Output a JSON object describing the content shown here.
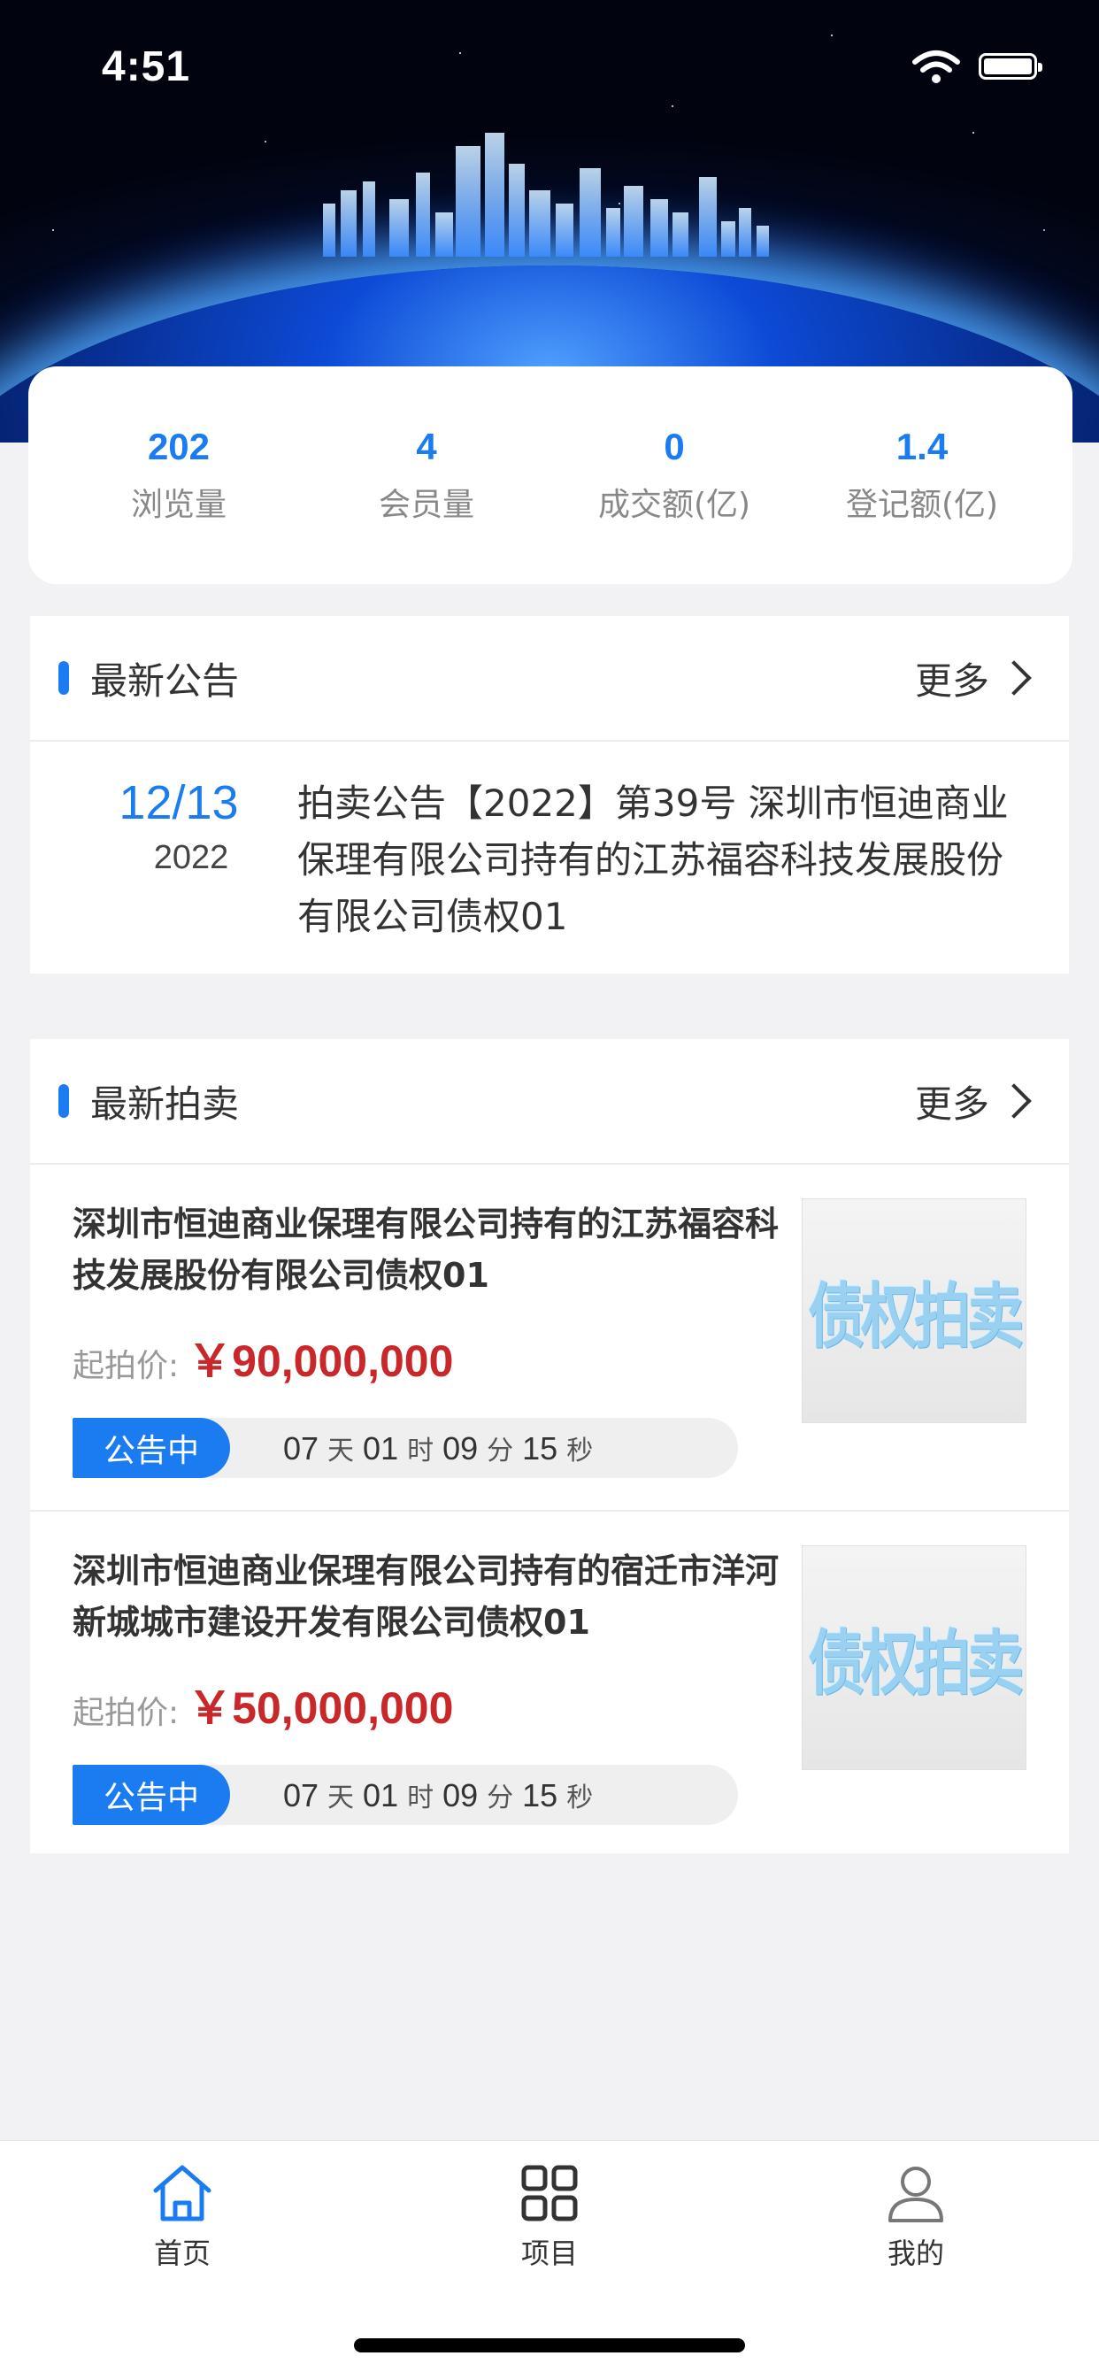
{
  "status_bar": {
    "time": "4:51"
  },
  "stats": [
    {
      "value": "202",
      "label": "浏览量"
    },
    {
      "value": "4",
      "label": "会员量"
    },
    {
      "value": "0",
      "label": "成交额(亿)"
    },
    {
      "value": "1.4",
      "label": "登记额(亿)"
    }
  ],
  "notices": {
    "title": "最新公告",
    "more": "更多",
    "items": [
      {
        "day": "12/13",
        "year": "2022",
        "text": "拍卖公告【2022】第39号 深圳市恒迪商业保理有限公司持有的江苏福容科技发展股份有限公司债权01"
      }
    ]
  },
  "auctions": {
    "title": "最新拍卖",
    "more": "更多",
    "items": [
      {
        "title": "深圳市恒迪商业保理有限公司持有的江苏福容科技发展股份有限公司债权01",
        "price_label": "起拍价:",
        "price": "￥90,000,000",
        "status": "公告中",
        "days": "07",
        "day_unit": "天",
        "hours": "01",
        "hour_unit": "时",
        "minutes": "09",
        "minute_unit": "分",
        "seconds": "15",
        "second_unit": "秒",
        "thumb_text": "债权拍卖"
      },
      {
        "title": "深圳市恒迪商业保理有限公司持有的宿迁市洋河新城城市建设开发有限公司债权01",
        "price_label": "起拍价:",
        "price": "￥50,000,000",
        "status": "公告中",
        "days": "07",
        "day_unit": "天",
        "hours": "01",
        "hour_unit": "时",
        "minutes": "09",
        "minute_unit": "分",
        "seconds": "15",
        "second_unit": "秒",
        "thumb_text": "债权拍卖"
      }
    ]
  },
  "tab_bar": {
    "active_color": "#1a7cf0",
    "tabs": [
      {
        "label": "首页",
        "icon": "home-icon",
        "active": true
      },
      {
        "label": "项目",
        "icon": "grid-icon",
        "active": false
      },
      {
        "label": "我的",
        "icon": "user-icon",
        "active": false
      }
    ]
  }
}
